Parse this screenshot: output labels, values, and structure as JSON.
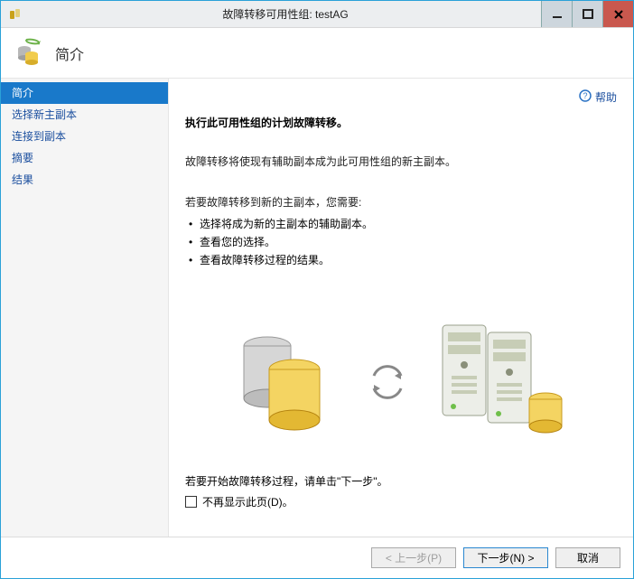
{
  "titlebar": {
    "title": "故障转移可用性组: testAG"
  },
  "header": {
    "page_title": "简介"
  },
  "sidebar": {
    "items": [
      {
        "label": "简介"
      },
      {
        "label": "选择新主副本"
      },
      {
        "label": "连接到副本"
      },
      {
        "label": "摘要"
      },
      {
        "label": "结果"
      }
    ]
  },
  "content": {
    "help_label": "帮助",
    "main_heading": "执行此可用性组的计划故障转移。",
    "explain_para": "故障转移将使现有辅助副本成为此可用性组的新主副本。",
    "need_intro": "若要故障转移到新的主副本，您需要:",
    "need_items": [
      "选择将成为新的主副本的辅助副本。",
      "查看您的选择。",
      "查看故障转移过程的结果。"
    ],
    "start_para": "若要开始故障转移过程，请单击\"下一步\"。",
    "dont_show_label": "不再显示此页(D)。"
  },
  "footer": {
    "prev": "<  上一步(P)",
    "next": "下一步(N)  >",
    "cancel": "取消"
  }
}
